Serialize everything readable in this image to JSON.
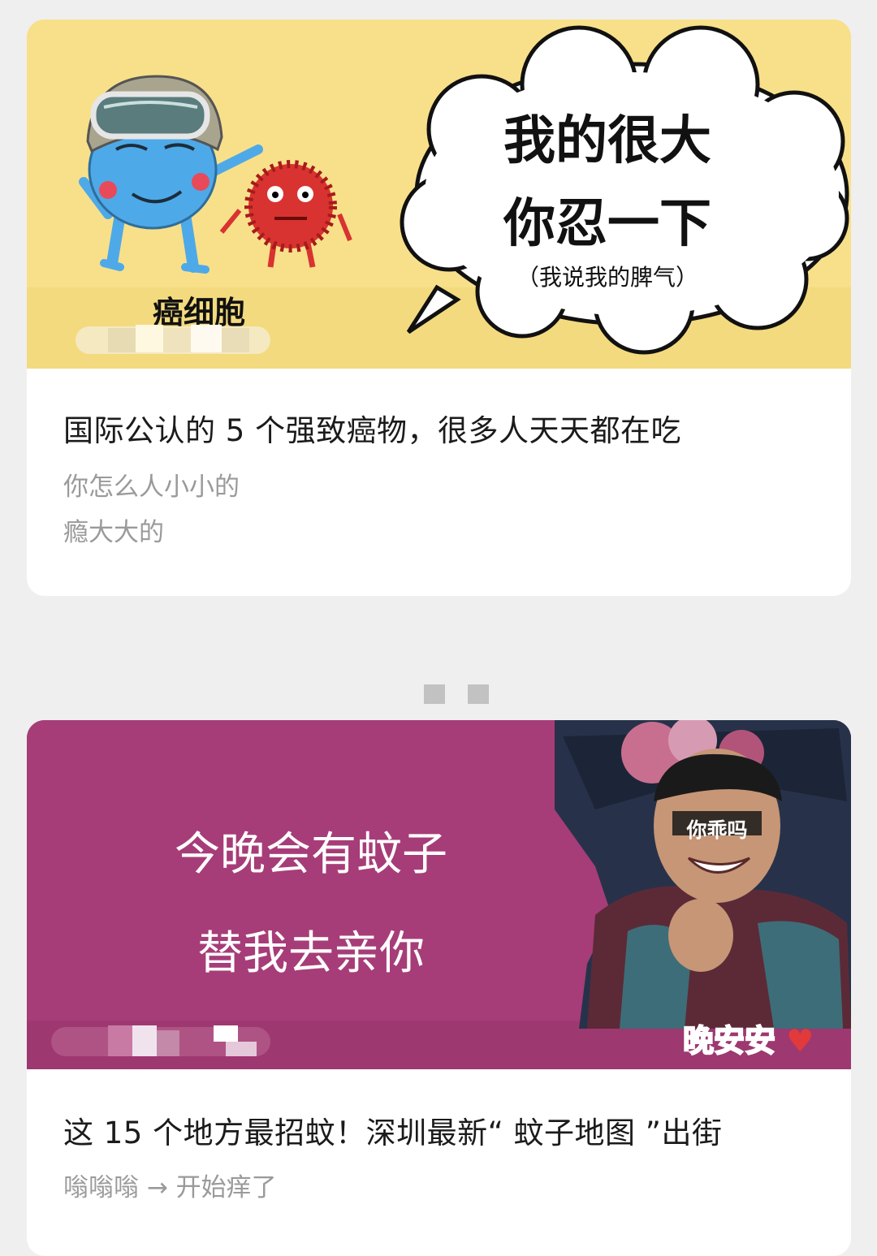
{
  "articles": [
    {
      "cover": {
        "character_label": "癌细胞",
        "bubble_line1": "我的很大",
        "bubble_line2": "你忍一下",
        "bubble_note": "（我说我的脾气）",
        "background_color": "#f8e08a"
      },
      "title": "国际公认的 5 个强致癌物，很多人天天都在吃",
      "digest": [
        "你怎么人小小的",
        "瘾大大的"
      ]
    },
    {
      "cover": {
        "line1": "今晚会有蚊子",
        "line2": "替我去亲你",
        "face_label": "你乖吗",
        "corner_label": "晚安安",
        "background_color": "#a63d78"
      },
      "title": "这 15 个地方最招蚊！深圳最新“ 蚊子地图 ”出街",
      "digest": [
        "嗡嗡嗡 → 开始痒了"
      ]
    }
  ],
  "icons": {
    "heart": "heart-icon",
    "separator": "pixel-dots-icon"
  }
}
